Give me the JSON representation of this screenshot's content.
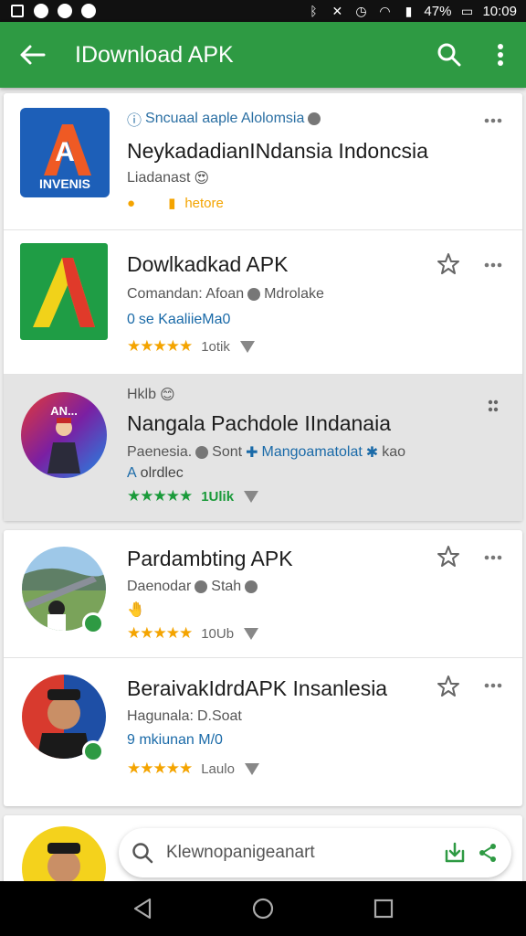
{
  "status": {
    "battery": "47%",
    "time": "10:09"
  },
  "appbar": {
    "title": "IDownload APK"
  },
  "apps": [
    {
      "publisher": "Sncuaal aaple Alolomsia",
      "title": "NeykadadianINdansia Indoncsia",
      "developer": "Liadanast",
      "link": "",
      "extra": "hetore",
      "rating": "",
      "count": "",
      "icon_text": "A",
      "icon_caption": "INVENIS"
    },
    {
      "publisher": "",
      "title": "Dowlkadkad APK",
      "developer": "Comandan: Afoan",
      "developer_tag": "Mdrolake",
      "link": "se KaaliieMa0",
      "link_prefix": "0",
      "rating": "★★★★★",
      "count": "1otik",
      "icon_text": "A"
    },
    {
      "publisher": "Hklb",
      "title": "Nangala Pachdole IIndanaia",
      "developer": "Paenesia.",
      "developer_tag": "Sont",
      "link_extra": "Mangoamatolat",
      "link_after": "kao",
      "link": "A",
      "link_2": "olrdlec",
      "rating": "★★★★★",
      "count": "1Ulik",
      "icon_text": "AN..."
    },
    {
      "publisher": "",
      "title": "Pardambting APK",
      "developer": "Daenodar",
      "developer_tag": "Stah",
      "link": "",
      "rating": "★★★★★",
      "count": "10Ub",
      "icon_text": ""
    },
    {
      "publisher": "",
      "title": "BeraivakIdrdAPK Insanlesia",
      "developer": "Hagunala:",
      "developer_tag": "D.Soat",
      "link": "9 mkiunan M/0",
      "rating": "★★★★★",
      "count": "Laulo",
      "icon_text": ""
    }
  ],
  "search": {
    "placeholder": "Klewnopanigeanart"
  },
  "colors": {
    "appbar": "#2e9a43",
    "accent_green": "#1a9a3a",
    "star": "#f4a400",
    "link": "#1a6aa8"
  }
}
